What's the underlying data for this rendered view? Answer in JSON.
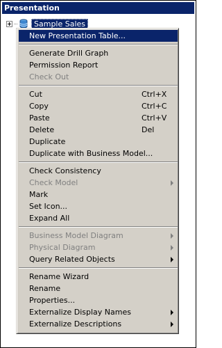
{
  "panel": {
    "title": "Presentation"
  },
  "tree": {
    "label": "Sample Sales",
    "icon": "database-icon"
  },
  "menu": {
    "group1": [
      {
        "label": "New Presentation Table...",
        "highlighted": true
      }
    ],
    "group2": [
      {
        "label": "Generate Drill Graph"
      },
      {
        "label": "Permission Report"
      },
      {
        "label": "Check Out",
        "disabled": true
      }
    ],
    "group3": [
      {
        "label": "Cut",
        "shortcut": "Ctrl+X"
      },
      {
        "label": "Copy",
        "shortcut": "Ctrl+C"
      },
      {
        "label": "Paste",
        "shortcut": "Ctrl+V"
      },
      {
        "label": "Delete",
        "shortcut": "Del"
      },
      {
        "label": "Duplicate"
      },
      {
        "label": "Duplicate with Business Model..."
      }
    ],
    "group4": [
      {
        "label": "Check Consistency"
      },
      {
        "label": "Check Model",
        "disabled": true,
        "submenu": true
      },
      {
        "label": "Mark"
      },
      {
        "label": "Set Icon..."
      },
      {
        "label": "Expand All"
      }
    ],
    "group5": [
      {
        "label": "Business Model Diagram",
        "disabled": true,
        "submenu": true
      },
      {
        "label": "Physical Diagram",
        "disabled": true,
        "submenu": true
      },
      {
        "label": "Query Related Objects",
        "submenu": true
      }
    ],
    "group6": [
      {
        "label": "Rename Wizard"
      },
      {
        "label": "Rename"
      },
      {
        "label": "Properties..."
      },
      {
        "label": "Externalize Display Names",
        "submenu": true
      },
      {
        "label": "Externalize Descriptions",
        "submenu": true
      }
    ]
  }
}
